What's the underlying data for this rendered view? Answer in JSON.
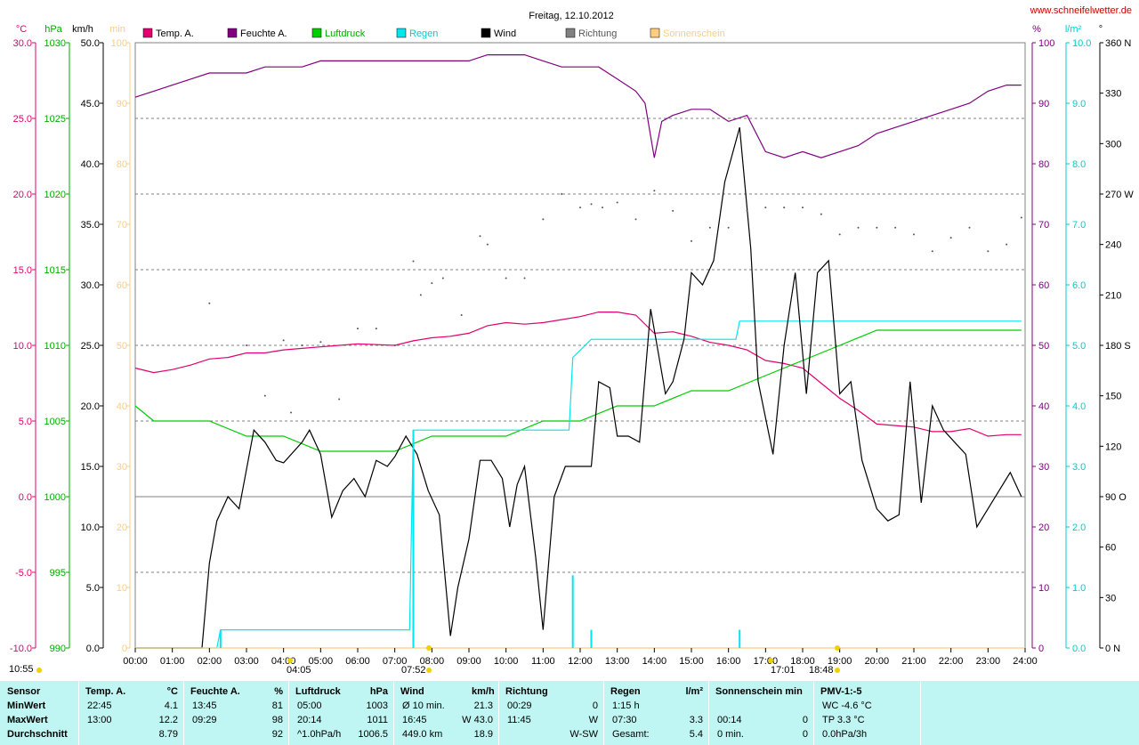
{
  "title": "Freitag, 12.10.2012",
  "website": "www.schneifelwetter.de",
  "unit_labels": {
    "temp": "°C",
    "pressure": "hPa",
    "wind": "km/h",
    "sun": "min",
    "humidity": "%",
    "rain": "l/m²",
    "direction": "°"
  },
  "legend": [
    {
      "label": "Temp. A.",
      "color": "#e0006f"
    },
    {
      "label": "Feuchte A.",
      "color": "#800080"
    },
    {
      "label": "Luftdruck",
      "color": "#00cc00"
    },
    {
      "label": "Regen",
      "color": "#00e5ee"
    },
    {
      "label": "Wind",
      "color": "#000000"
    },
    {
      "label": "Richtung",
      "color": "#808080"
    },
    {
      "label": "Sonnenschein",
      "color": "#ffcc80"
    }
  ],
  "markers": {
    "sunrise_left": "10:55",
    "moonrise": "04:05",
    "sunrise": "07:52",
    "sunset": "17:01",
    "moonset": "18:48"
  },
  "chart_data": {
    "type": "line",
    "title": "Freitag, 12.10.2012",
    "x_range": [
      0,
      24
    ],
    "x_ticks": [
      "00:00",
      "01:00",
      "02:00",
      "03:00",
      "04:00",
      "05:00",
      "06:00",
      "07:00",
      "08:00",
      "09:00",
      "10:00",
      "11:00",
      "12:00",
      "13:00",
      "14:00",
      "15:00",
      "16:00",
      "17:00",
      "18:00",
      "19:00",
      "20:00",
      "21:00",
      "22:00",
      "23:00",
      "24:00"
    ],
    "axes": {
      "temp": {
        "min": -10,
        "max": 30,
        "ticks": [
          "-10.0",
          "-5.0",
          "0.0",
          "5.0",
          "10.0",
          "15.0",
          "20.0",
          "25.0",
          "30.0"
        ],
        "color": "#e0006f"
      },
      "pressure": {
        "min": 990,
        "max": 1030,
        "ticks": [
          "990",
          "995",
          "1000",
          "1005",
          "1010",
          "1015",
          "1020",
          "1025",
          "1030"
        ],
        "color": "#00aa00"
      },
      "wind": {
        "min": 0,
        "max": 50,
        "ticks": [
          "0.0",
          "5.0",
          "10.0",
          "15.0",
          "20.0",
          "25.0",
          "30.0",
          "35.0",
          "40.0",
          "45.0",
          "50.0"
        ],
        "color": "#000000"
      },
      "sun": {
        "min": 0,
        "max": 100,
        "ticks": [
          "0",
          "10",
          "20",
          "30",
          "40",
          "50",
          "60",
          "70",
          "80",
          "90",
          "100"
        ],
        "color": "#ffcc80"
      },
      "humidity": {
        "min": 0,
        "max": 100,
        "ticks": [
          "0",
          "10",
          "20",
          "30",
          "40",
          "50",
          "60",
          "70",
          "80",
          "90",
          "100"
        ],
        "color": "#800080"
      },
      "rain": {
        "min": 0,
        "max": 10,
        "ticks": [
          "0.0",
          "1.0",
          "2.0",
          "3.0",
          "4.0",
          "5.0",
          "6.0",
          "7.0",
          "8.0",
          "9.0",
          "10.0"
        ],
        "color": "#00cccc"
      },
      "direction": {
        "min": 0,
        "max": 360,
        "ticks": [
          "0 N",
          "30",
          "60",
          "90 O",
          "120",
          "150",
          "180 S",
          "210",
          "240",
          "270 W",
          "300",
          "330",
          "360 N"
        ],
        "color": "#000000"
      }
    },
    "series": [
      {
        "name": "Temp. A.",
        "axis": "temp",
        "color": "#e0006f",
        "points": [
          [
            0,
            8.5
          ],
          [
            0.5,
            8.2
          ],
          [
            1,
            8.4
          ],
          [
            1.5,
            8.7
          ],
          [
            2,
            9.1
          ],
          [
            2.5,
            9.2
          ],
          [
            3,
            9.5
          ],
          [
            3.5,
            9.5
          ],
          [
            4,
            9.7
          ],
          [
            4.5,
            9.8
          ],
          [
            5,
            9.9
          ],
          [
            5.5,
            10.0
          ],
          [
            6,
            10.1
          ],
          [
            7,
            10.0
          ],
          [
            7.5,
            10.3
          ],
          [
            8,
            10.5
          ],
          [
            8.5,
            10.6
          ],
          [
            9,
            10.8
          ],
          [
            9.5,
            11.3
          ],
          [
            10,
            11.5
          ],
          [
            10.5,
            11.4
          ],
          [
            11,
            11.5
          ],
          [
            11.5,
            11.7
          ],
          [
            12,
            11.9
          ],
          [
            12.5,
            12.2
          ],
          [
            13,
            12.2
          ],
          [
            13.5,
            12.0
          ],
          [
            14,
            10.8
          ],
          [
            14.5,
            10.9
          ],
          [
            15,
            10.6
          ],
          [
            15.5,
            10.2
          ],
          [
            16,
            10.0
          ],
          [
            16.5,
            9.7
          ],
          [
            17,
            9.0
          ],
          [
            17.5,
            8.8
          ],
          [
            18,
            8.5
          ],
          [
            18.5,
            7.5
          ],
          [
            19,
            6.5
          ],
          [
            19.5,
            5.7
          ],
          [
            20,
            4.8
          ],
          [
            20.5,
            4.7
          ],
          [
            21,
            4.6
          ],
          [
            21.5,
            4.3
          ],
          [
            22,
            4.3
          ],
          [
            22.5,
            4.5
          ],
          [
            23,
            4.0
          ],
          [
            23.5,
            4.1
          ],
          [
            23.9,
            4.1
          ]
        ]
      },
      {
        "name": "Feuchte A.",
        "axis": "humidity",
        "color": "#800080",
        "points": [
          [
            0,
            91
          ],
          [
            0.5,
            92
          ],
          [
            1,
            93
          ],
          [
            1.5,
            94
          ],
          [
            2,
            95
          ],
          [
            2.5,
            95
          ],
          [
            3,
            95
          ],
          [
            3.5,
            96
          ],
          [
            4,
            96
          ],
          [
            4.5,
            96
          ],
          [
            5,
            97
          ],
          [
            6,
            97
          ],
          [
            7,
            97
          ],
          [
            8,
            97
          ],
          [
            9,
            97
          ],
          [
            9.5,
            98
          ],
          [
            10,
            98
          ],
          [
            10.5,
            98
          ],
          [
            11,
            97
          ],
          [
            11.5,
            96
          ],
          [
            12,
            96
          ],
          [
            12.5,
            96
          ],
          [
            13,
            94
          ],
          [
            13.5,
            92
          ],
          [
            13.75,
            90
          ],
          [
            14,
            81
          ],
          [
            14.2,
            87
          ],
          [
            14.5,
            88
          ],
          [
            15,
            89
          ],
          [
            15.5,
            89
          ],
          [
            16,
            87
          ],
          [
            16.5,
            88
          ],
          [
            17,
            82
          ],
          [
            17.5,
            81
          ],
          [
            18,
            82
          ],
          [
            18.5,
            81
          ],
          [
            19,
            82
          ],
          [
            19.5,
            83
          ],
          [
            20,
            85
          ],
          [
            20.5,
            86
          ],
          [
            21,
            87
          ],
          [
            21.5,
            88
          ],
          [
            22,
            89
          ],
          [
            22.5,
            90
          ],
          [
            23,
            92
          ],
          [
            23.5,
            93
          ],
          [
            23.9,
            93
          ]
        ]
      },
      {
        "name": "Luftdruck",
        "axis": "pressure",
        "color": "#00cc00",
        "points": [
          [
            0,
            1006
          ],
          [
            0.5,
            1005
          ],
          [
            1,
            1005
          ],
          [
            2,
            1005
          ],
          [
            3,
            1004
          ],
          [
            4,
            1004
          ],
          [
            5,
            1003
          ],
          [
            6,
            1003
          ],
          [
            7,
            1003
          ],
          [
            8,
            1004
          ],
          [
            9,
            1004
          ],
          [
            10,
            1004
          ],
          [
            11,
            1005
          ],
          [
            12,
            1005
          ],
          [
            13,
            1006
          ],
          [
            14,
            1006
          ],
          [
            15,
            1007
          ],
          [
            16,
            1007
          ],
          [
            17,
            1008
          ],
          [
            18,
            1009
          ],
          [
            19,
            1010
          ],
          [
            20,
            1011
          ],
          [
            21,
            1011
          ],
          [
            22,
            1011
          ],
          [
            23,
            1011
          ],
          [
            23.9,
            1011
          ]
        ]
      },
      {
        "name": "Regen",
        "axis": "rain",
        "color": "#00e5ee",
        "points": [
          [
            0,
            0
          ],
          [
            2.2,
            0
          ],
          [
            2.3,
            0.3
          ],
          [
            7.4,
            0.3
          ],
          [
            7.5,
            3.6
          ],
          [
            11.7,
            3.6
          ],
          [
            11.8,
            4.8
          ],
          [
            12.3,
            5.1
          ],
          [
            16.2,
            5.1
          ],
          [
            16.3,
            5.4
          ],
          [
            23.9,
            5.4
          ]
        ]
      },
      {
        "name": "Wind",
        "axis": "wind",
        "color": "#000000",
        "points": [
          [
            0,
            0
          ],
          [
            1.8,
            0
          ],
          [
            2,
            7
          ],
          [
            2.2,
            10.5
          ],
          [
            2.5,
            12.5
          ],
          [
            2.8,
            11.5
          ],
          [
            3.2,
            18
          ],
          [
            3.5,
            17
          ],
          [
            3.8,
            15.5
          ],
          [
            4,
            15.3
          ],
          [
            4.5,
            17
          ],
          [
            4.7,
            18
          ],
          [
            5,
            16
          ],
          [
            5.3,
            10.8
          ],
          [
            5.6,
            13
          ],
          [
            5.9,
            14
          ],
          [
            6.2,
            12.5
          ],
          [
            6.5,
            15.5
          ],
          [
            6.8,
            15
          ],
          [
            7,
            15.8
          ],
          [
            7.3,
            17.5
          ],
          [
            7.6,
            16
          ],
          [
            7.9,
            13
          ],
          [
            8.2,
            11
          ],
          [
            8.5,
            1
          ],
          [
            8.7,
            5
          ],
          [
            9,
            9
          ],
          [
            9.3,
            15.5
          ],
          [
            9.6,
            15.5
          ],
          [
            9.9,
            14
          ],
          [
            10.1,
            10
          ],
          [
            10.3,
            13.5
          ],
          [
            10.5,
            15
          ],
          [
            10.8,
            7.5
          ],
          [
            11,
            1.5
          ],
          [
            11.3,
            12.5
          ],
          [
            11.6,
            15
          ],
          [
            12,
            15
          ],
          [
            12.3,
            15
          ],
          [
            12.5,
            22
          ],
          [
            12.8,
            21.5
          ],
          [
            13,
            17.5
          ],
          [
            13.3,
            17.5
          ],
          [
            13.6,
            17
          ],
          [
            13.9,
            28
          ],
          [
            14.3,
            21
          ],
          [
            14.5,
            22
          ],
          [
            14.8,
            25.5
          ],
          [
            15,
            31
          ],
          [
            15.3,
            30
          ],
          [
            15.6,
            32
          ],
          [
            15.9,
            38.5
          ],
          [
            16.3,
            43
          ],
          [
            16.6,
            33
          ],
          [
            16.8,
            22
          ],
          [
            17.2,
            16
          ],
          [
            17.5,
            25
          ],
          [
            17.8,
            31
          ],
          [
            18.1,
            21
          ],
          [
            18.4,
            31
          ],
          [
            18.7,
            32
          ],
          [
            19,
            21
          ],
          [
            19.3,
            22
          ],
          [
            19.6,
            15.5
          ],
          [
            20,
            11.5
          ],
          [
            20.3,
            10.5
          ],
          [
            20.6,
            11
          ],
          [
            20.9,
            22
          ],
          [
            21.2,
            12
          ],
          [
            21.5,
            20
          ],
          [
            21.8,
            18
          ],
          [
            22.1,
            17
          ],
          [
            22.4,
            16
          ],
          [
            22.7,
            10
          ],
          [
            23,
            11.5
          ],
          [
            23.3,
            13
          ],
          [
            23.6,
            14.5
          ],
          [
            23.9,
            12.5
          ],
          [
            24.2,
            13
          ],
          [
            24.5,
            8
          ],
          [
            24.8,
            10
          ],
          [
            25.1,
            14
          ],
          [
            25.3,
            11
          ],
          [
            25.6,
            17
          ],
          [
            25.9,
            17.5
          ]
        ]
      },
      {
        "name": "Richtung",
        "axis": "direction",
        "color": "#808080",
        "points": []
      },
      {
        "name": "Sonnenschein",
        "axis": "sun",
        "color": "#ffcc80",
        "points": [
          [
            0,
            0
          ],
          [
            24,
            0
          ]
        ]
      }
    ]
  },
  "stats": {
    "headers": [
      {
        "label": "Sensor",
        "unit": ""
      },
      {
        "label": "Temp. A.",
        "unit": "°C"
      },
      {
        "label": "Feuchte A.",
        "unit": "%"
      },
      {
        "label": "Luftdruck",
        "unit": "hPa"
      },
      {
        "label": "Wind",
        "unit": "km/h"
      },
      {
        "label": "Richtung",
        "unit": ""
      },
      {
        "label": "Regen",
        "unit": "l/m²"
      },
      {
        "label": "Sonnenschein min",
        "unit": ""
      },
      {
        "label": "PMV-1:-5",
        "unit": ""
      }
    ],
    "rows": [
      {
        "label": "MinWert",
        "cells": [
          [
            "22:45",
            "4.1"
          ],
          [
            "13:45",
            "81"
          ],
          [
            "05:00",
            "1003"
          ],
          [
            "Ø 10 min.",
            "21.3"
          ],
          [
            "00:29",
            "0"
          ],
          [
            "1:15 h",
            ""
          ],
          [
            "",
            ""
          ],
          [
            "WC -4.6 °C",
            ""
          ]
        ]
      },
      {
        "label": "MaxWert",
        "cells": [
          [
            "13:00",
            "12.2"
          ],
          [
            "09:29",
            "98"
          ],
          [
            "20:14",
            "1011"
          ],
          [
            "16:45",
            "W 43.0"
          ],
          [
            "11:45",
            "W"
          ],
          [
            "07:30",
            "3.3"
          ],
          [
            "00:14",
            "0"
          ],
          [
            "TP 3.3 °C",
            ""
          ]
        ]
      },
      {
        "label": "Durchschnitt",
        "cells": [
          [
            "",
            "8.79"
          ],
          [
            "",
            "92"
          ],
          [
            "^1.0hPa/h",
            "1006.5"
          ],
          [
            "449.0 km",
            "18.9"
          ],
          [
            "",
            "W-SW"
          ],
          [
            "Gesamt:",
            "5.4"
          ],
          [
            "0 min.",
            "0"
          ],
          [
            "0.0hPa/3h",
            ""
          ]
        ]
      }
    ]
  }
}
